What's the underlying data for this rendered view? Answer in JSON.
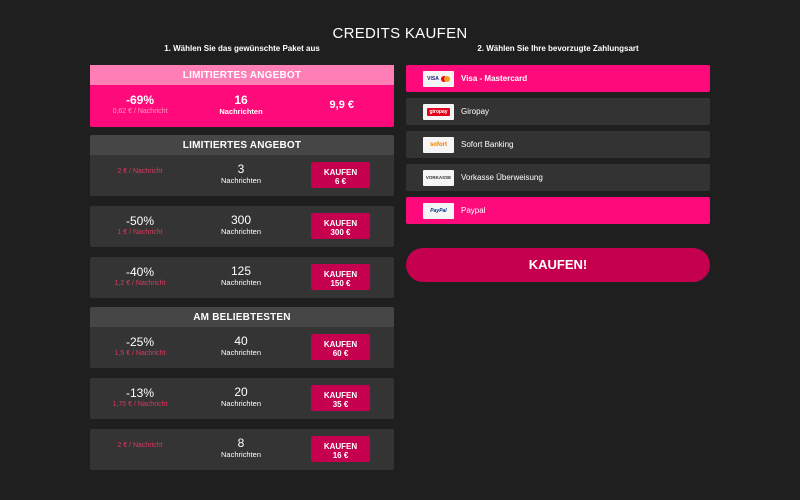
{
  "title": "CREDITS KAUFEN",
  "steps": {
    "step1": "1. Wählen Sie das gewünschte Paket aus",
    "step2": "2. Wählen Sie Ihre bevorzugte Zahlungsart"
  },
  "featured": {
    "banner": "LIMITIERTES ANGEBOT",
    "discount": "-69%",
    "per_message": "0,62 € / Nachricht",
    "count": "16",
    "unit": "Nachrichten",
    "price": "9,9 €"
  },
  "sections": {
    "limited": "LIMITIERTES ANGEBOT",
    "popular": "AM BELIEBTESTEN"
  },
  "packages": [
    {
      "discount": "",
      "per_message": "2 € / Nachricht",
      "count": "3",
      "unit": "Nachrichten",
      "buy": "KAUFEN",
      "price": "6 €"
    },
    {
      "discount": "-50%",
      "per_message": "1 € / Nachricht",
      "count": "300",
      "unit": "Nachrichten",
      "buy": "KAUFEN",
      "price": "300 €"
    },
    {
      "discount": "-40%",
      "per_message": "1,2 € / Nachricht",
      "count": "125",
      "unit": "Nachrichten",
      "buy": "KAUFEN",
      "price": "150 €"
    },
    {
      "discount": "-25%",
      "per_message": "1,5 € / Nachricht",
      "count": "40",
      "unit": "Nachrichten",
      "buy": "KAUFEN",
      "price": "60 €"
    },
    {
      "discount": "-13%",
      "per_message": "1,75 € / Nachricht",
      "count": "20",
      "unit": "Nachrichten",
      "buy": "KAUFEN",
      "price": "35 €"
    },
    {
      "discount": "",
      "per_message": "2 € / Nachricht",
      "count": "8",
      "unit": "Nachrichten",
      "buy": "KAUFEN",
      "price": "16 €"
    }
  ],
  "payments": [
    {
      "label": "Visa - Mastercard",
      "icon": "visa-mastercard-icon",
      "icon_text": "VISA"
    },
    {
      "label": "Giropay",
      "icon": "giropay-icon",
      "icon_text": "giropay"
    },
    {
      "label": "Sofort Banking",
      "icon": "sofort-icon",
      "icon_text": "sofort"
    },
    {
      "label": "Vorkasse Überweisung",
      "icon": "vorkasse-icon",
      "icon_text": "VORKASSE"
    },
    {
      "label": "Paypal",
      "icon": "paypal-icon",
      "icon_text": "PayPal"
    }
  ],
  "buy_button": "KAUFEN!",
  "colors": {
    "background": "#1f1f1f",
    "accent_pink": "#ff0a7a",
    "banner_pink": "#ff7eb5",
    "button_magenta": "#c5004e",
    "row_grey": "#343434",
    "header_grey": "#464646"
  }
}
